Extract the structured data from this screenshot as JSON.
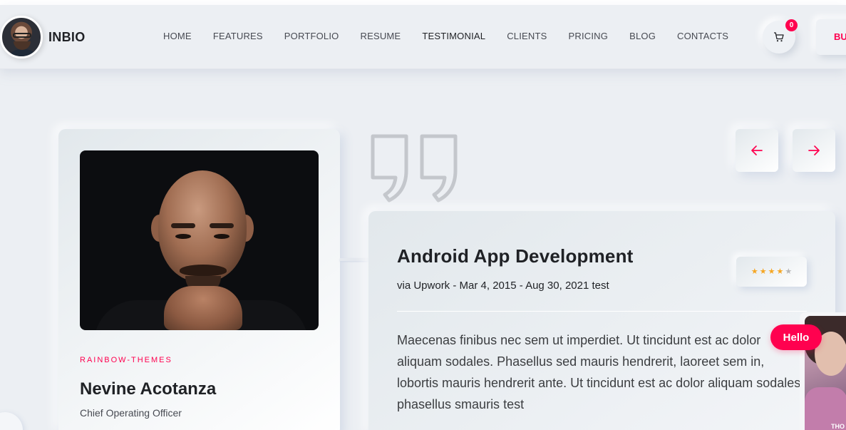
{
  "brand": {
    "name": "INBIO"
  },
  "nav": {
    "items": [
      {
        "label": "HOME"
      },
      {
        "label": "FEATURES"
      },
      {
        "label": "PORTFOLIO"
      },
      {
        "label": "RESUME"
      },
      {
        "label": "TESTIMONIAL",
        "active": true
      },
      {
        "label": "CLIENTS"
      },
      {
        "label": "PRICING"
      },
      {
        "label": "BLOG"
      },
      {
        "label": "CONTACTS"
      }
    ],
    "cart_count": "0",
    "buy_label": "BU"
  },
  "profile": {
    "company": "RAINBOW-THEMES",
    "name": "Nevine Acotanza",
    "role": "Chief Operating Officer"
  },
  "testimonial": {
    "title": "Android App Development",
    "meta": "via Upwork - Mar 4, 2015 - Aug 30, 2021 test",
    "rating": 4,
    "rating_max": 5,
    "body": "Maecenas finibus nec sem ut imperdiet. Ut tincidunt est ac dolor aliquam sodales. Phasellus sed mauris hendrerit, laoreet sem in, lobortis mauris hendrerit ante. Ut tincidunt est ac dolor aliquam sodales phasellus smauris test"
  },
  "chat": {
    "bubble": "Hello",
    "video_tag": "THO"
  },
  "colors": {
    "accent": "#ff014f",
    "background": "#eceff3",
    "star_filled": "#f5a623",
    "star_empty": "#b7b7b7"
  },
  "icons": {
    "cart": "cart-icon",
    "prev": "arrow-left-icon",
    "next": "arrow-right-icon",
    "quote": "quote-icon",
    "star": "star-icon"
  }
}
